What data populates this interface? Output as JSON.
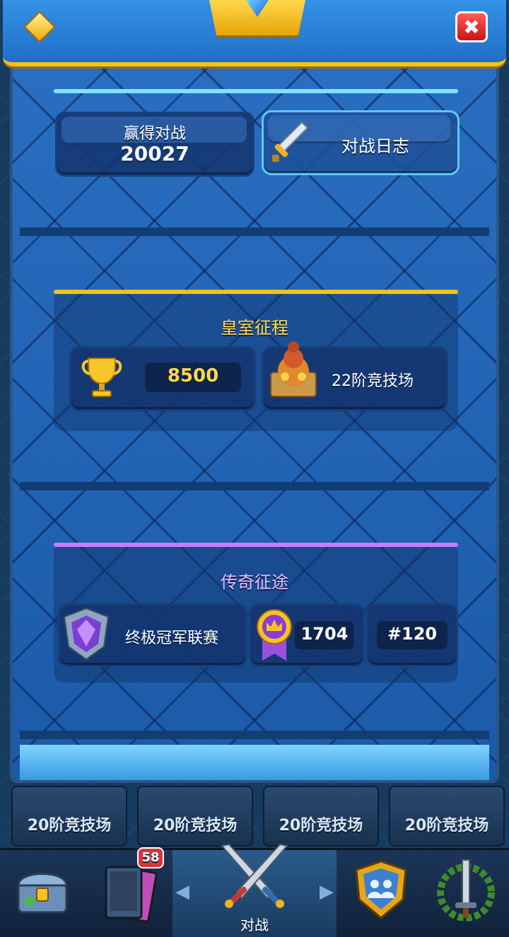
{
  "header": {
    "close_label": "✖"
  },
  "stats": {
    "wins_label": "赢得对战",
    "wins_value": "20027",
    "battle_log_label": "对战日志"
  },
  "royal_road": {
    "title": "皇室征程",
    "trophies": "8500",
    "arena_label": "22阶竞技场"
  },
  "legendary_path": {
    "title": "传奇征途",
    "league_label": "终极冠军联赛",
    "rating": "1704",
    "rank": "#120"
  },
  "arena_row": [
    {
      "label": "20阶竞技场"
    },
    {
      "label": "20阶竞技场"
    },
    {
      "label": "20阶竞技场"
    },
    {
      "label": "20阶竞技场"
    }
  ],
  "navbar": {
    "cards_badge": "58",
    "battle_label": "对战"
  },
  "colors": {
    "gold_divider": "#f3c31b",
    "cyan_divider": "#7fe3ff",
    "purple_divider": "#c77dff",
    "title_yellow": "#ffd94a",
    "title_purple": "#e6b8ff"
  }
}
